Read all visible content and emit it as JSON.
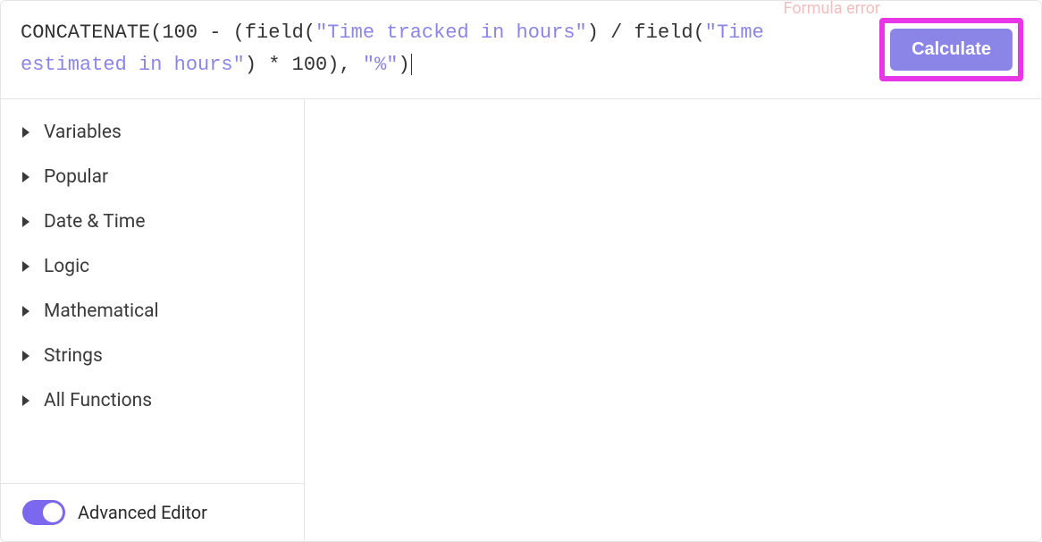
{
  "formula": {
    "tokens": [
      {
        "type": "fn",
        "text": "CONCATENATE"
      },
      {
        "type": "plain",
        "text": "(100 - ("
      },
      {
        "type": "fn",
        "text": "field"
      },
      {
        "type": "plain",
        "text": "("
      },
      {
        "type": "str",
        "text": "\"Time tracked in hours\""
      },
      {
        "type": "plain",
        "text": ") / "
      },
      {
        "type": "fn",
        "text": "field"
      },
      {
        "type": "plain",
        "text": "("
      },
      {
        "type": "str",
        "text": "\"Time estimated in hours\""
      },
      {
        "type": "plain",
        "text": ") * 100), "
      },
      {
        "type": "str",
        "text": "\"%\""
      },
      {
        "type": "plain",
        "text": ")"
      }
    ]
  },
  "error_hint": "Formula error",
  "calculate_label": "Calculate",
  "sidebar": {
    "categories": [
      {
        "label": "Variables"
      },
      {
        "label": "Popular"
      },
      {
        "label": "Date & Time"
      },
      {
        "label": "Logic"
      },
      {
        "label": "Mathematical"
      },
      {
        "label": "Strings"
      },
      {
        "label": "All Functions"
      }
    ],
    "advanced_editor_label": "Advanced Editor",
    "advanced_editor_on": true
  }
}
